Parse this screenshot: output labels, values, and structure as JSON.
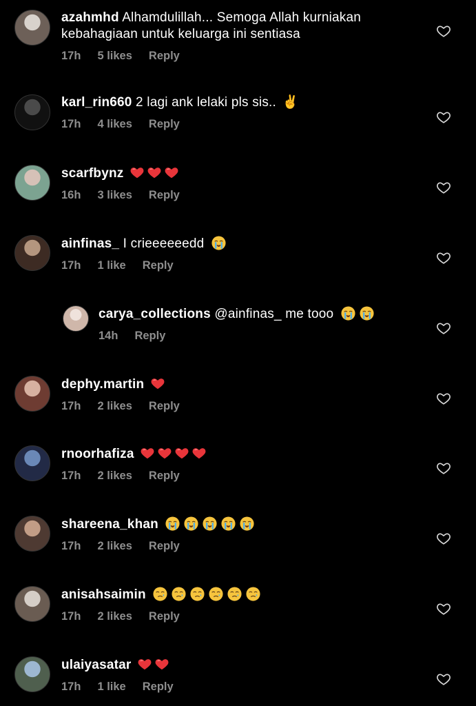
{
  "comments": [
    {
      "username": "azahmhd",
      "text": "Alhamdulillah... Semoga Allah kurniakan kebahagiaan untuk keluarga ini sentiasa",
      "time": "17h",
      "likes": "5 likes",
      "reply": "Reply",
      "avatar_colors": [
        "#d8d2cc",
        "#6d6058"
      ],
      "avatar_icon": "avatar"
    },
    {
      "username": "karl_rin660",
      "text": "2 lagi ank lelaki pls sis.. ✌️",
      "time": "17h",
      "likes": "4 likes",
      "reply": "Reply",
      "avatar_colors": [
        "#4a4a4a",
        "#111111"
      ],
      "avatar_icon": "avatar"
    },
    {
      "username": "scarfbynz",
      "text": "",
      "emoji": "red-heart",
      "emoji_count": 3,
      "time": "16h",
      "likes": "3 likes",
      "reply": "Reply",
      "avatar_colors": [
        "#d6c1b7",
        "#7ca391"
      ],
      "avatar_icon": "avatar"
    },
    {
      "username": "ainfinas_",
      "text": "I crieeeeeedd 😭",
      "time": "17h",
      "likes": "1 like",
      "reply": "Reply",
      "avatar_colors": [
        "#b4967f",
        "#3d2b23"
      ],
      "avatar_icon": "avatar"
    },
    {
      "username": "carya_collections",
      "text": "@ainfinas_ me tooo 😭😭",
      "time": "14h",
      "likes": "",
      "reply": "Reply",
      "avatar_colors": [
        "#efe2dc",
        "#cfb7aa"
      ],
      "avatar_icon": "avatar",
      "is_reply": true
    },
    {
      "username": "dephy.martin",
      "text": "",
      "emoji": "red-heart",
      "emoji_count": 1,
      "time": "17h",
      "likes": "2 likes",
      "reply": "Reply",
      "avatar_colors": [
        "#d7b1a1",
        "#6e3c32"
      ],
      "avatar_icon": "avatar"
    },
    {
      "username": "rnoorhafiza",
      "text": "",
      "emoji": "red-heart",
      "emoji_count": 4,
      "time": "17h",
      "likes": "2 likes",
      "reply": "Reply",
      "avatar_colors": [
        "#6a88b7",
        "#222a46"
      ],
      "avatar_icon": "avatar"
    },
    {
      "username": "shareena_khan",
      "text": "",
      "emoji": "loudly-crying",
      "emoji_count": 5,
      "time": "17h",
      "likes": "2 likes",
      "reply": "Reply",
      "avatar_colors": [
        "#c29d86",
        "#4e3a32"
      ],
      "avatar_icon": "avatar"
    },
    {
      "username": "anisahsaimin",
      "text": "",
      "emoji": "crying",
      "emoji_count": 6,
      "time": "17h",
      "likes": "2 likes",
      "reply": "Reply",
      "avatar_colors": [
        "#d5cec7",
        "#6a5c52"
      ],
      "avatar_icon": "avatar"
    },
    {
      "username": "ulaiyasatar",
      "text": "",
      "emoji": "red-heart",
      "emoji_count": 2,
      "time": "17h",
      "likes": "1 like",
      "reply": "Reply",
      "avatar_colors": [
        "#9db7d1",
        "#4f5f4e"
      ],
      "avatar_icon": "avatar"
    }
  ],
  "colors": {
    "background": "#000000",
    "text": "#ffffff",
    "meta": "#8e8e8e",
    "heart_emoji": "#e8353a",
    "cry_emoji": "#f6c43d"
  },
  "icons": {
    "like": "heart-outline-icon",
    "heart_emoji": "red-heart",
    "cry_emoji": "loudly-crying-face"
  }
}
